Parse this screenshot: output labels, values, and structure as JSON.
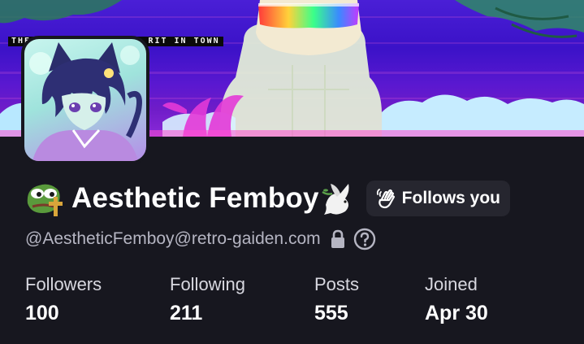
{
  "banner": {
    "caption_left": "THE",
    "caption_right": "RIT IN TOWN"
  },
  "profile": {
    "display_name": "Aesthetic Femboy",
    "name_emoji_left": "pepe-cross-emoji",
    "name_emoji_right": "dove-emoji",
    "follows_you_label": "Follows you",
    "handle": "@AestheticFemboy@retro-gaiden.com",
    "locked": true
  },
  "stats": [
    {
      "label": "Followers",
      "value": "100"
    },
    {
      "label": "Following",
      "value": "211"
    },
    {
      "label": "Posts",
      "value": "555"
    },
    {
      "label": "Joined",
      "value": "Apr 30"
    }
  ],
  "colors": {
    "page_background": "#17171f",
    "badge_background": "#26262f",
    "handle_text": "#b5b5c2",
    "banner_purple": "#4a1fd6",
    "banner_magenta": "#e43ad8"
  }
}
